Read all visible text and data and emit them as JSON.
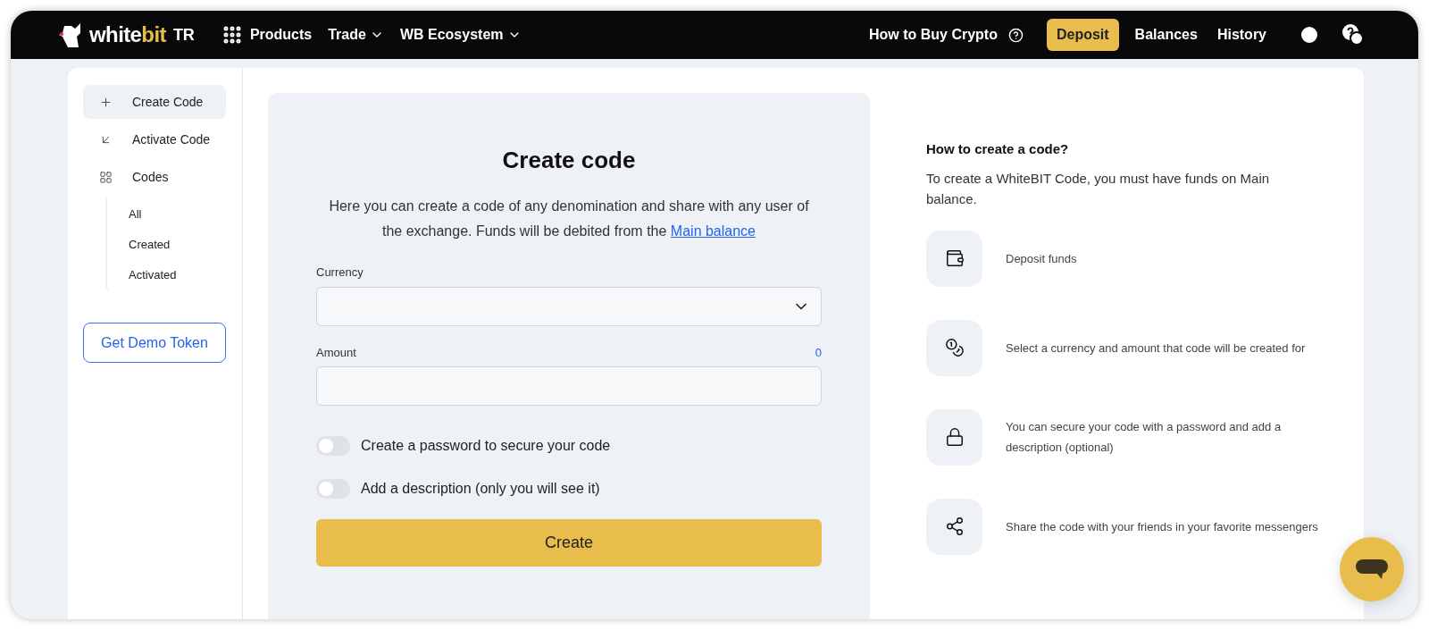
{
  "header": {
    "logo": {
      "part_1": "white",
      "part_2": "bit",
      "suffix": "TR"
    },
    "nav": [
      {
        "label": "Products",
        "kind": "grid"
      },
      {
        "label": "Trade",
        "kind": "dropdown"
      },
      {
        "label": "WB Ecosystem",
        "kind": "dropdown"
      }
    ],
    "help_link": "How to Buy Crypto",
    "deposit_button": "Deposit",
    "links": [
      "Balances",
      "History"
    ]
  },
  "sidebar": {
    "items": [
      {
        "label": "Create Code",
        "kind": "create",
        "selected": true
      },
      {
        "label": "Activate Code",
        "kind": "activate",
        "selected": false
      },
      {
        "label": "Codes",
        "kind": "codes",
        "selected": false,
        "children": [
          {
            "label": "All",
            "selected": false
          },
          {
            "label": "Created",
            "selected": false
          },
          {
            "label": "Activated",
            "selected": false
          }
        ]
      }
    ],
    "demo_button": "Get Demo Token"
  },
  "form": {
    "title": "Create code",
    "description": "Here you can create a code of any denomination and share with any user of the exchange. Funds will be debited from the",
    "description_link": "Main balance",
    "currency_label": "Currency",
    "amount_label": "Amount",
    "amount_available": "0",
    "toggles": [
      {
        "label": "Create a password to secure your code",
        "on": false
      },
      {
        "label": "Add a description (only you will see it)",
        "on": false
      }
    ],
    "create_button": "Create"
  },
  "info": {
    "title": "How to create a code?",
    "subtitle": "To create a WhiteBIT Code, you must have funds on Main balance.",
    "steps": [
      {
        "kind": "wallet",
        "text": "Deposit funds"
      },
      {
        "kind": "coins",
        "text": "Select a currency and amount that code will be created for"
      },
      {
        "kind": "lock",
        "text": "You can secure your code with a password and add a description (optional)"
      },
      {
        "kind": "share",
        "text": "Share the code with your friends in your favorite messengers"
      }
    ]
  }
}
